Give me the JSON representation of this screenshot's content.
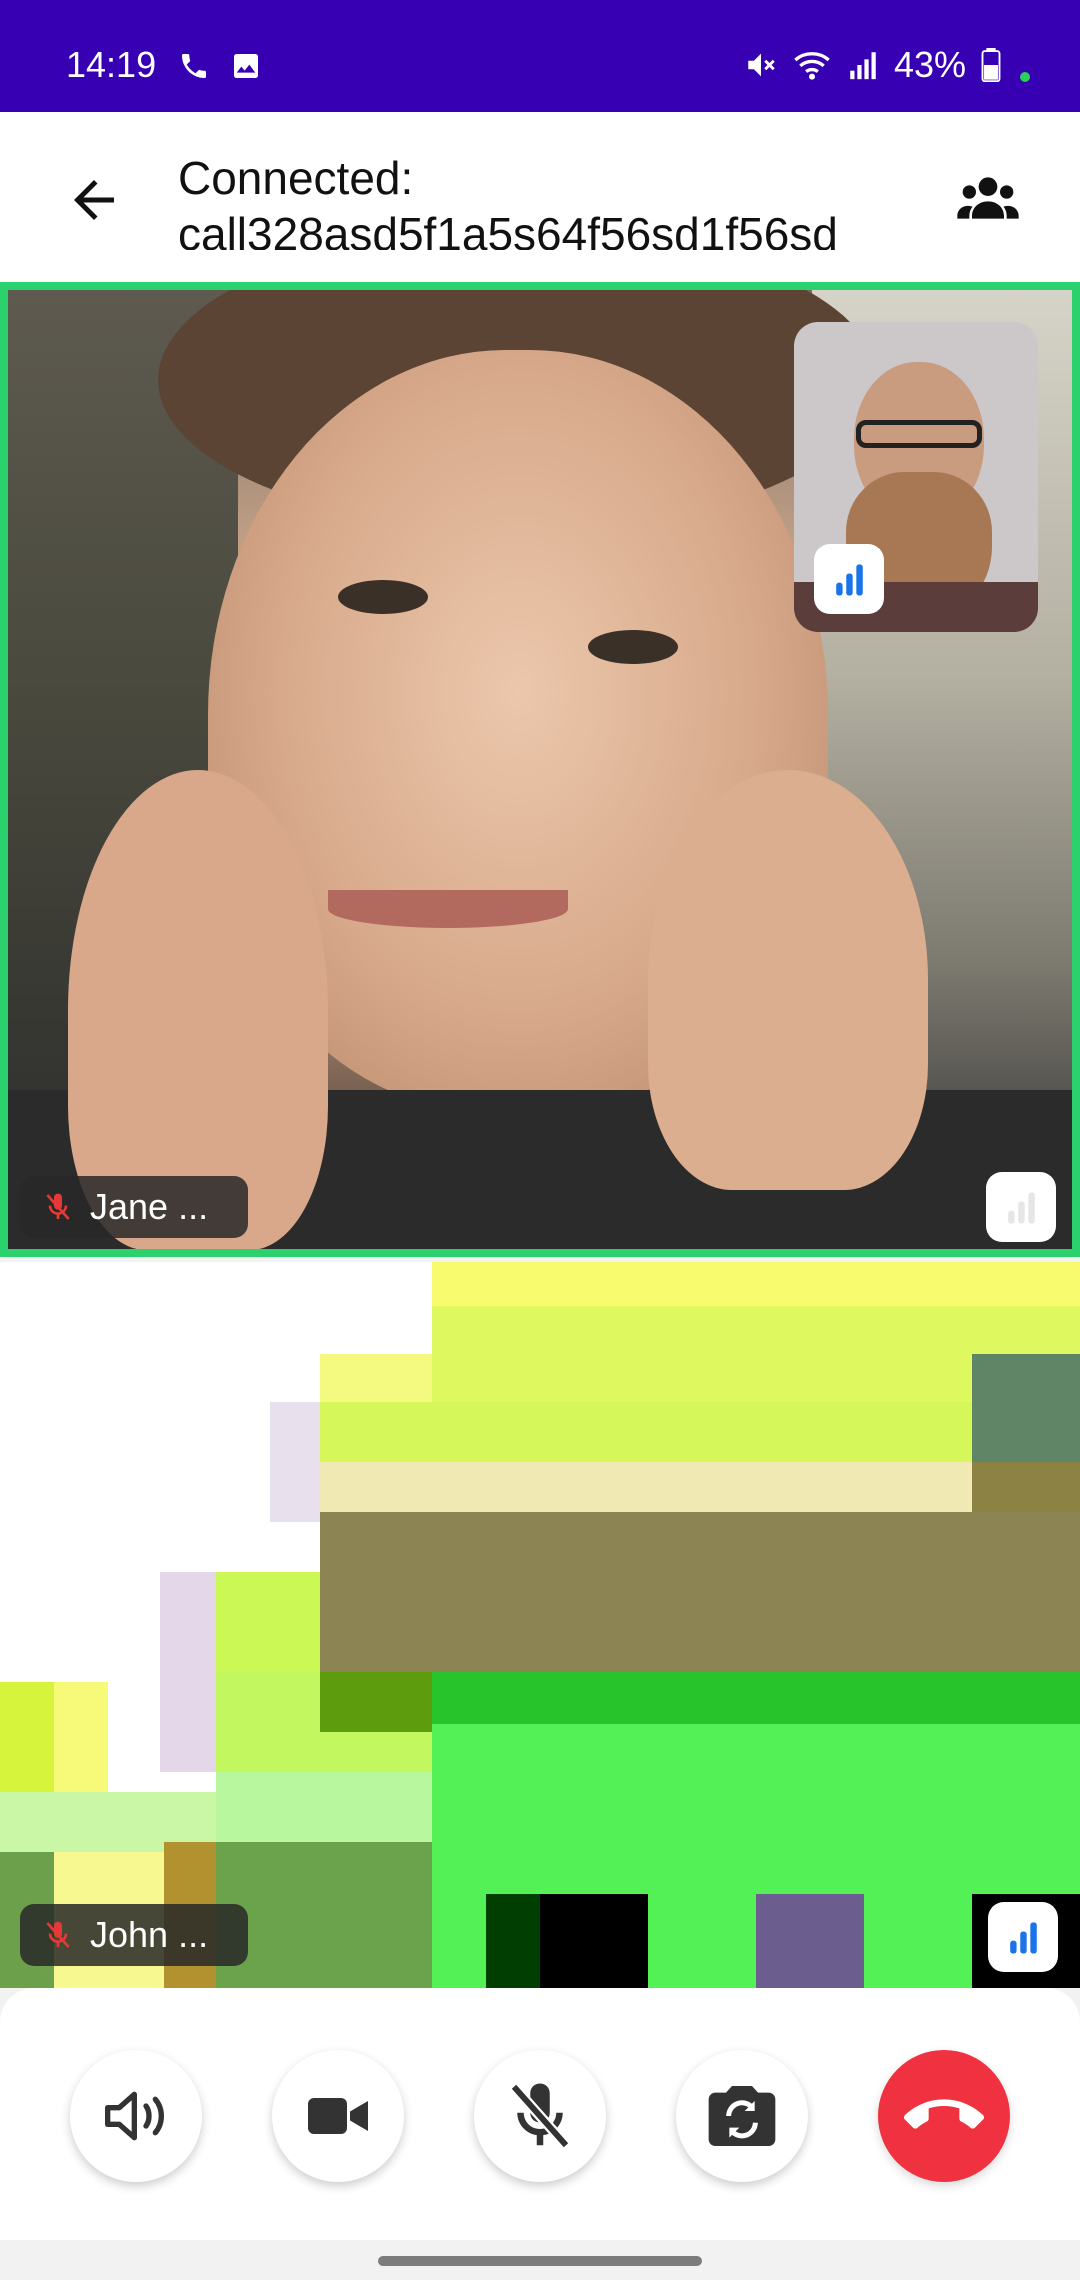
{
  "status_bar": {
    "time": "14:19",
    "battery": "43%",
    "icons": [
      "phone-icon",
      "image-icon",
      "mute-icon",
      "wifi-icon",
      "signal-icon",
      "battery-icon"
    ],
    "background": "#3700b3"
  },
  "app_bar": {
    "title_line1": "Connected:",
    "title_line2": "call328asd5f1a5s64f56sd1f56sd",
    "back_icon": "arrow-left-icon",
    "participants_icon": "group-icon"
  },
  "participants": [
    {
      "name": "Jane ...",
      "muted": true,
      "active_speaker": true,
      "signal": "weak"
    },
    {
      "name": "John ...",
      "muted": true,
      "active_speaker": false,
      "signal": "good"
    }
  ],
  "controls": {
    "buttons": [
      "speaker-icon",
      "camera-icon",
      "mic-off-icon",
      "flip-camera-icon",
      "hang-up-icon"
    ],
    "hangup_color": "#f0313f"
  },
  "colors": {
    "active_border": "#2bd16c",
    "signal_blue": "#1a73e8"
  }
}
